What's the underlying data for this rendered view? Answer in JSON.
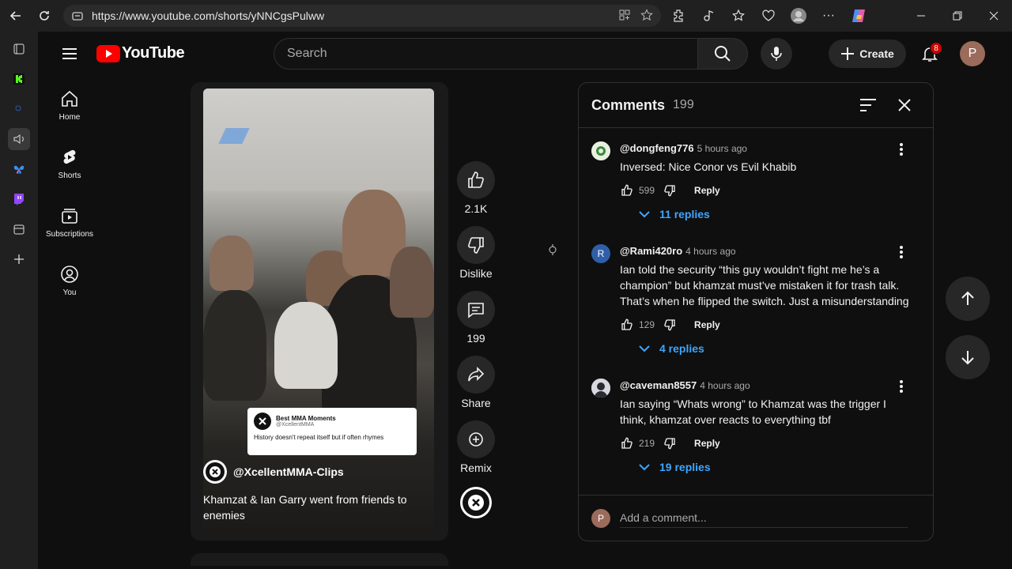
{
  "browser": {
    "url": "https://www.youtube.com/shorts/yNNCgsPulww"
  },
  "header": {
    "logo_text": "YouTube",
    "search_placeholder": "Search",
    "create_label": "Create",
    "notifications_count": "8",
    "avatar_letter": "P"
  },
  "nav": {
    "items": [
      {
        "label": "Home",
        "icon": "home-icon"
      },
      {
        "label": "Shorts",
        "icon": "shorts-icon"
      },
      {
        "label": "Subscriptions",
        "icon": "subscriptions-icon"
      },
      {
        "label": "You",
        "icon": "you-icon"
      }
    ]
  },
  "video": {
    "channel": "@XcellentMMA-Clips",
    "title": "Khamzat & Ian Garry went from friends to enemies",
    "tweet": {
      "name": "Best MMA Moments",
      "handle": "@XcellentMMA",
      "text": "History doesn't repeat itself but if often rhymes"
    }
  },
  "actions": {
    "likes": "2.1K",
    "dislike_label": "Dislike",
    "comments": "199",
    "share_label": "Share",
    "remix_label": "Remix"
  },
  "comments": {
    "title": "Comments",
    "count": "199",
    "add_placeholder": "Add a comment...",
    "user_letter": "P",
    "reply_label": "Reply",
    "items": [
      {
        "author": "@dongfeng776",
        "time": "5 hours ago",
        "text": "Inversed: Nice Conor vs Evil Khabib",
        "likes": "599",
        "replies": "11 replies",
        "avatar_color": "#e8f0e0",
        "avatar_letter": ""
      },
      {
        "author": "@Rami420ro",
        "time": "4 hours ago",
        "text": "Ian told the security “this guy wouldn’t fight me he’s a champion” but khamzat must’ve mistaken it for trash talk. That’s when he flipped the switch. Just a misunderstanding",
        "likes": "129",
        "replies": "4 replies",
        "avatar_color": "#2f5fa8",
        "avatar_letter": "R"
      },
      {
        "author": "@caveman8557",
        "time": "4 hours ago",
        "text": "Ian saying “Whats wrong” to Khamzat was the trigger I think, khamzat over reacts to everything tbf",
        "likes": "219",
        "replies": "19 replies",
        "avatar_color": "#d8d8e0",
        "avatar_letter": ""
      }
    ]
  },
  "colors": {
    "accent_blue": "#3ea6ff",
    "brand_red": "#ff0000",
    "badge_red": "#cc0000"
  }
}
